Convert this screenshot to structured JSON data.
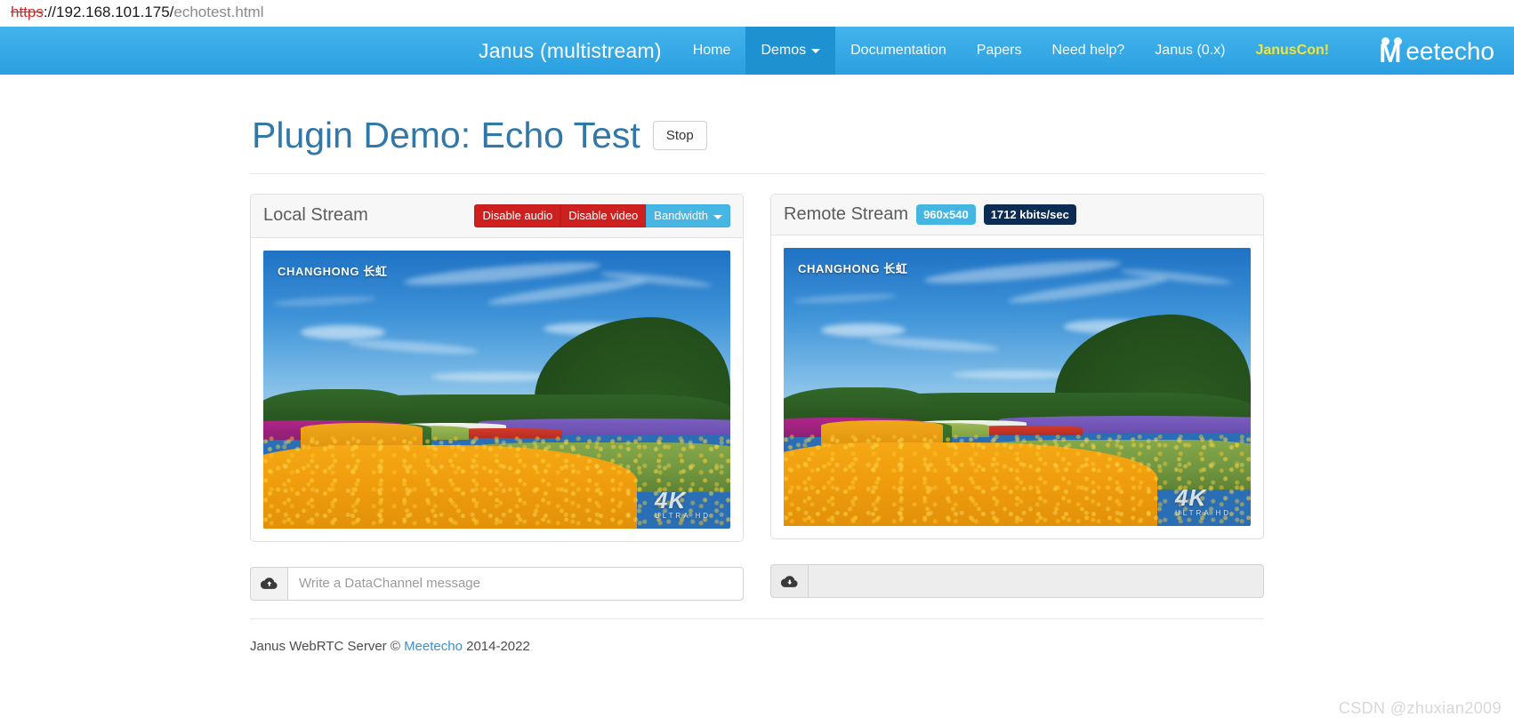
{
  "browser": {
    "url_scheme": "https",
    "url_host": "://192.168.101.175/",
    "url_path": "echotest.html"
  },
  "navbar": {
    "brand": "Janus (multistream)",
    "items": [
      {
        "label": "Home",
        "active": false,
        "caret": false,
        "highlight": false
      },
      {
        "label": "Demos",
        "active": true,
        "caret": true,
        "highlight": false
      },
      {
        "label": "Documentation",
        "active": false,
        "caret": false,
        "highlight": false
      },
      {
        "label": "Papers",
        "active": false,
        "caret": false,
        "highlight": false
      },
      {
        "label": "Need help?",
        "active": false,
        "caret": false,
        "highlight": false
      },
      {
        "label": "Janus (0.x)",
        "active": false,
        "caret": false,
        "highlight": false
      },
      {
        "label": "JanusCon!",
        "active": false,
        "caret": false,
        "highlight": true
      }
    ],
    "logo_m": "M",
    "logo_rest": "eetecho",
    "bg_color": "#2ba0e0",
    "active_color": "#1e91d0",
    "highlight_color": "#f2e437"
  },
  "page": {
    "title": "Plugin Demo: Echo Test",
    "stop_label": "Stop",
    "title_color": "#3177a8"
  },
  "local": {
    "panel_title": "Local Stream",
    "disable_audio_label": "Disable audio",
    "disable_video_label": "Disable video",
    "bandwidth_label": "Bandwidth",
    "danger_color": "#cf2020",
    "info_color": "#48b6e3",
    "video": {
      "watermark_brand": "CHANGHONG 长虹",
      "watermark_quality": "4K",
      "watermark_quality_sub": "ULTRA HD"
    },
    "datachannel_placeholder": "Write a DataChannel message",
    "datachannel_value": "",
    "upload_icon": "cloud-upload-icon"
  },
  "remote": {
    "panel_title": "Remote Stream",
    "resolution_badge": "960x540",
    "bitrate_badge": "1712 kbits/sec",
    "resolution_color": "#45b5e2",
    "bitrate_color": "#0d2c54",
    "video": {
      "watermark_brand": "CHANGHONG 长虹",
      "watermark_quality": "4K",
      "watermark_quality_sub": "ULTRA HD"
    },
    "datachannel_placeholder": "",
    "datachannel_value": "",
    "download_icon": "cloud-download-icon"
  },
  "footer": {
    "prefix": "Janus WebRTC Server © ",
    "link": "Meetecho",
    "suffix": " 2014-2022"
  },
  "watermark": {
    "text": "CSDN @zhuxian2009"
  }
}
